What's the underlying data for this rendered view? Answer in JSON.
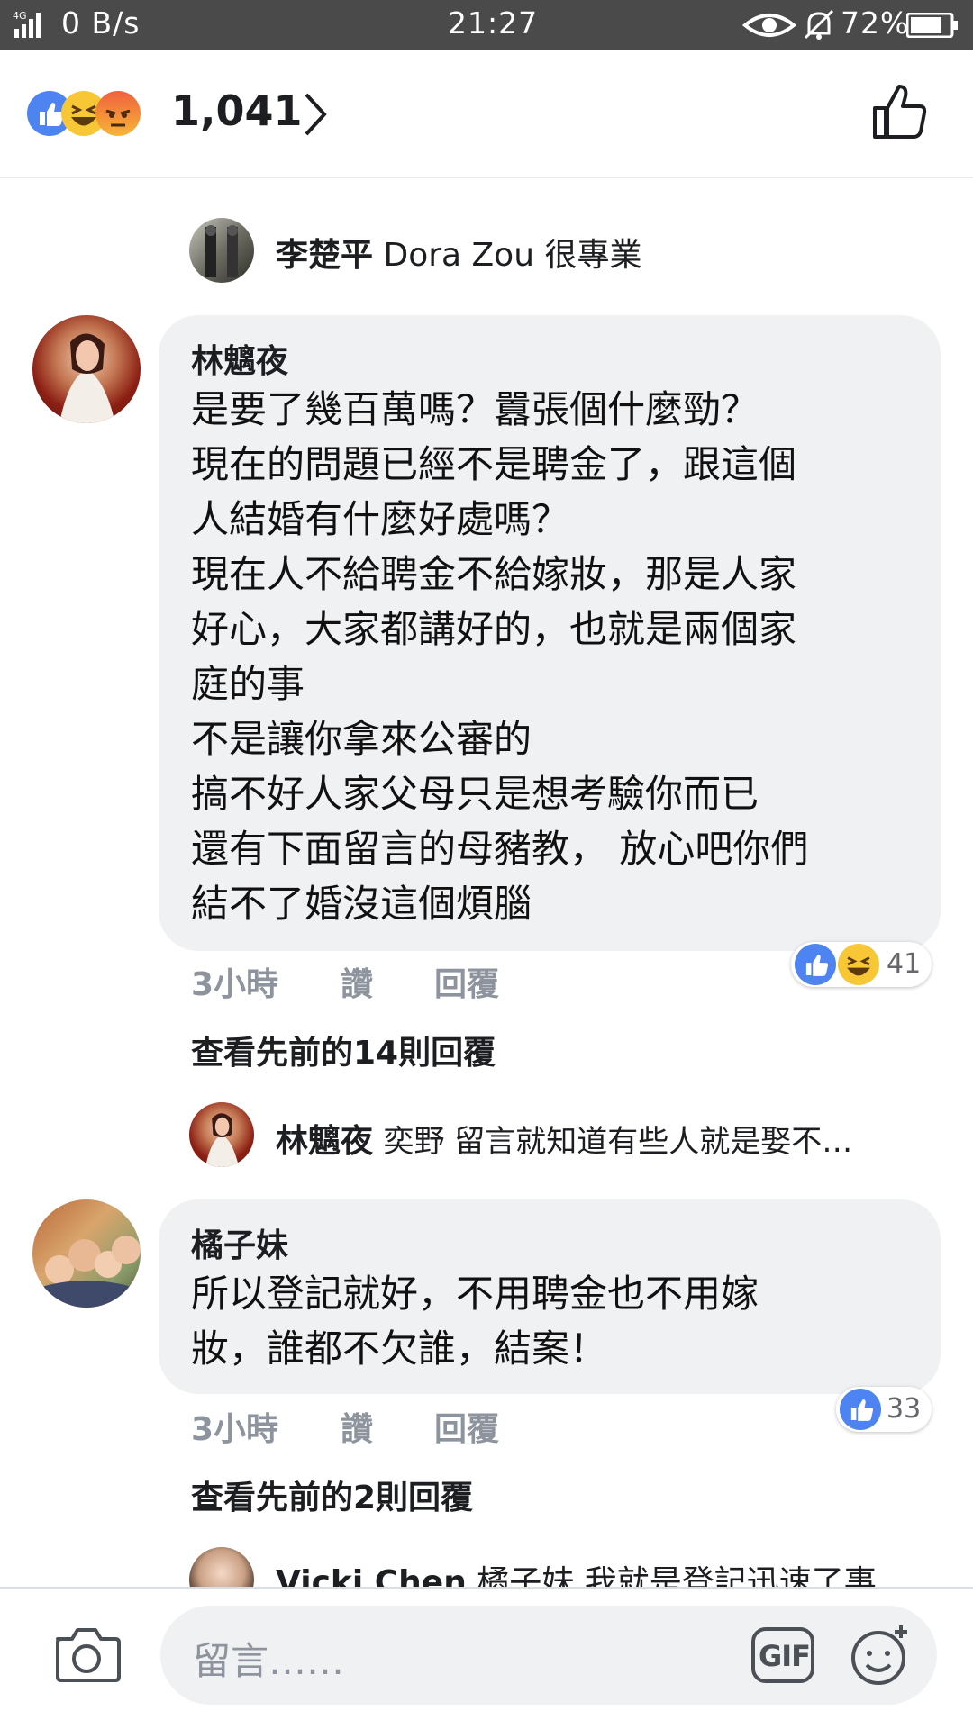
{
  "status_bar": {
    "network": "4G",
    "speed": "0 B/s",
    "time": "21:27",
    "battery": "72%"
  },
  "reactions_header": {
    "count": "1,041",
    "icons": [
      "like-icon",
      "haha-icon",
      "angry-icon"
    ]
  },
  "comments": {
    "reply_top": {
      "name": "李楚平",
      "text": "Dora Zou 很專業"
    },
    "c1": {
      "name": "林魑夜",
      "lines": [
        "是要了幾百萬嗎？囂張個什麼勁？",
        "現在的問題已經不是聘金了，跟這個",
        "人結婚有什麼好處嗎？",
        "現在人不給聘金不給嫁妝，那是人家",
        "好心，大家都講好的，也就是兩個家",
        "庭的事",
        "不是讓你拿來公審的",
        "搞不好人家父母只是想考驗你而已",
        "還有下面留言的母豬教， 放心吧你們",
        "結不了婚沒這個煩腦"
      ],
      "time": "3小時",
      "like": "讚",
      "reply": "回覆",
      "reaction_count": "41",
      "view_previous": "查看先前的14則回覆"
    },
    "c1_reply": {
      "name": "林魑夜",
      "text": "奕野 留言就知道有些人就是娶不…"
    },
    "c2": {
      "name": "橘子妹",
      "lines": [
        "所以登記就好，不用聘金也不用嫁",
        "妝，誰都不欠誰，結案！"
      ],
      "time": "3小時",
      "like": "讚",
      "reply": "回覆",
      "reaction_count": "33",
      "view_previous": "查看先前的2則回覆"
    },
    "c2_reply": {
      "name": "Vicki Chen",
      "text": "橘子妹 我就是登記迅速了事"
    }
  },
  "composer": {
    "placeholder": "留言……",
    "gif_label": "GIF"
  },
  "colors": {
    "like_blue": "#4e84f2",
    "bubble_gray": "#f0f1f3",
    "meta_gray": "#8d949e",
    "status_bar": "#4a4a4a"
  }
}
